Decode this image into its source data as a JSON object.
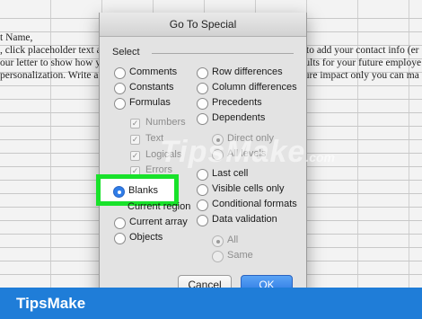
{
  "sheet": {
    "lines_left": [
      "t Name,",
      ", click placeholder text ar",
      "our letter to show how your",
      "personalization. Write a co"
    ],
    "lines_right": [
      "ter to add your contact info (er",
      "results for your future employe",
      "future impact only you can ma"
    ]
  },
  "dialog": {
    "title": "Go To Special",
    "group_label": "Select",
    "left_options": [
      {
        "label": "Comments",
        "kind": "radio",
        "selected": false,
        "disabled": false
      },
      {
        "label": "Constants",
        "kind": "radio",
        "selected": false,
        "disabled": false
      },
      {
        "label": "Formulas",
        "kind": "radio",
        "selected": false,
        "disabled": false
      },
      {
        "label": "Numbers",
        "kind": "checkbox",
        "checked": true,
        "disabled": true
      },
      {
        "label": "Text",
        "kind": "checkbox",
        "checked": true,
        "disabled": true
      },
      {
        "label": "Logicals",
        "kind": "checkbox",
        "checked": true,
        "disabled": true
      },
      {
        "label": "Errors",
        "kind": "checkbox",
        "checked": true,
        "disabled": true
      },
      {
        "label": "Blanks",
        "kind": "radio",
        "selected": true,
        "disabled": false
      },
      {
        "label": "Current region",
        "kind": "radio",
        "selected": false,
        "disabled": false
      },
      {
        "label": "Current array",
        "kind": "radio",
        "selected": false,
        "disabled": false
      },
      {
        "label": "Objects",
        "kind": "radio",
        "selected": false,
        "disabled": false
      }
    ],
    "right_options": [
      {
        "label": "Row differences",
        "kind": "radio",
        "selected": false,
        "disabled": false
      },
      {
        "label": "Column differences",
        "kind": "radio",
        "selected": false,
        "disabled": false
      },
      {
        "label": "Precedents",
        "kind": "radio",
        "selected": false,
        "disabled": false
      },
      {
        "label": "Dependents",
        "kind": "radio",
        "selected": false,
        "disabled": false
      },
      {
        "label": "Direct only",
        "kind": "radio",
        "selected": true,
        "disabled": true
      },
      {
        "label": "All levels",
        "kind": "radio",
        "selected": false,
        "disabled": true
      },
      {
        "label": "Last cell",
        "kind": "radio",
        "selected": false,
        "disabled": false
      },
      {
        "label": "Visible cells only",
        "kind": "radio",
        "selected": false,
        "disabled": false
      },
      {
        "label": "Conditional formats",
        "kind": "radio",
        "selected": false,
        "disabled": false
      },
      {
        "label": "Data validation",
        "kind": "radio",
        "selected": false,
        "disabled": false
      },
      {
        "label": "All",
        "kind": "radio",
        "selected": true,
        "disabled": true
      },
      {
        "label": "Same",
        "kind": "radio",
        "selected": false,
        "disabled": true
      }
    ],
    "cancel_label": "Cancel",
    "ok_label": "OK"
  },
  "watermark": {
    "main": "TipsMake",
    "suffix": ".com"
  },
  "brand": {
    "name": "TipsMake"
  },
  "colors": {
    "highlight": "#18e22a",
    "accent": "#2f7de8",
    "brand_bar": "#1f7dd8"
  }
}
